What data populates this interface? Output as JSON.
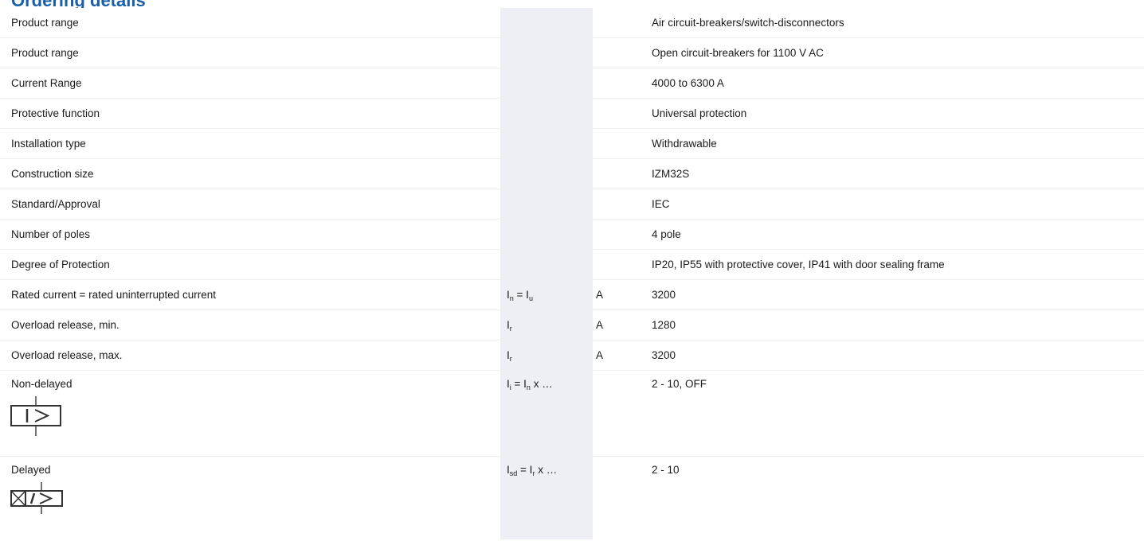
{
  "title": "Ordering details",
  "rows": [
    {
      "label": "Product range",
      "value": "Air circuit-breakers/switch-disconnectors"
    },
    {
      "label": "Product range",
      "value": "Open circuit-breakers for 1100 V AC"
    },
    {
      "label": "Current Range",
      "value": "4000 to 6300 A"
    },
    {
      "label": "Protective function",
      "value": "Universal protection"
    },
    {
      "label": "Installation type",
      "value": "Withdrawable"
    },
    {
      "label": "Construction size",
      "value": "IZM32S"
    },
    {
      "label": "Standard/Approval",
      "value": "IEC"
    },
    {
      "label": "Number of poles",
      "value": "4 pole"
    },
    {
      "label": "Degree of Protection",
      "value": "IP20, IP55 with protective cover, IP41 with door sealing frame"
    },
    {
      "label": "Rated current = rated uninterrupted current",
      "sym_a": "I",
      "sym_a_sub": "n",
      "sym_eq": " = ",
      "sym_b": "I",
      "sym_b_sub": "u",
      "unit": "A",
      "value": "3200"
    },
    {
      "label": "Overload release, min.",
      "sym_a": "I",
      "sym_a_sub": "r",
      "unit": "A",
      "value": "1280"
    },
    {
      "label": "Overload release, max.",
      "sym_a": "I",
      "sym_a_sub": "r",
      "unit": "A",
      "value": "3200"
    },
    {
      "label": "Non-delayed",
      "sym_a": "I",
      "sym_a_sub": "i",
      "sym_eq": " = ",
      "sym_b": "I",
      "sym_b_sub": "n",
      "sym_tail": " x …",
      "value": "2 - 10, OFF",
      "icon": "instantaneous-release-symbol-icon"
    },
    {
      "label": "Delayed",
      "sym_a": "I",
      "sym_a_sub": "sd",
      "sym_eq": " = ",
      "sym_b": "I",
      "sym_b_sub": "r",
      "sym_tail": " x …",
      "value": "2 - 10",
      "icon": "short-time-delayed-release-symbol-icon"
    }
  ]
}
